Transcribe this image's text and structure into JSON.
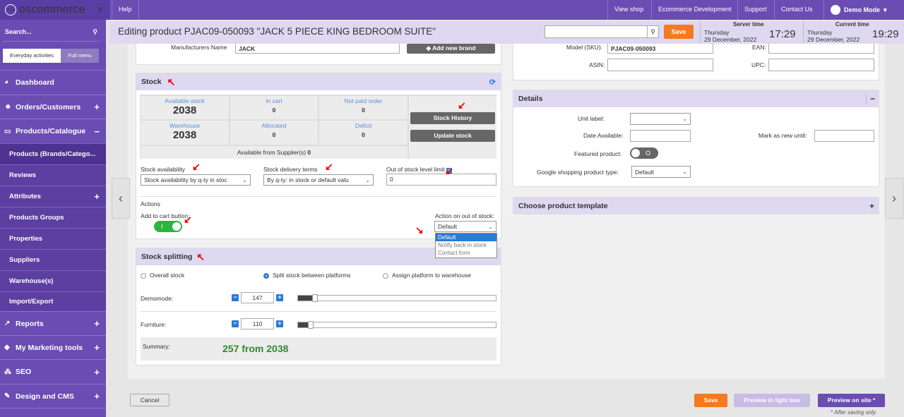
{
  "topbar": {
    "logo_text": "oscommerce",
    "help": "Help",
    "links": [
      "View shop",
      "Ecommerce Development",
      "Support",
      "Contact Us"
    ],
    "user": "Demo Mode"
  },
  "sidebar": {
    "search_label": "Search...",
    "toggle": [
      "Everyday activities",
      "Full menu"
    ],
    "items": [
      {
        "label": "Dashboard",
        "icon": "dashboard-icon",
        "plus": ""
      },
      {
        "label": "Orders/Customers",
        "icon": "users-icon",
        "plus": "+"
      },
      {
        "label": "Products/Catalogue",
        "icon": "folder-icon",
        "plus": "−"
      },
      {
        "label": "Reports",
        "icon": "chart-icon",
        "plus": "+"
      },
      {
        "label": "My Marketing tools",
        "icon": "tag-icon",
        "plus": "+"
      },
      {
        "label": "SEO",
        "icon": "sitemap-icon",
        "plus": "+"
      },
      {
        "label": "Design and CMS",
        "icon": "brush-icon",
        "plus": "+"
      }
    ],
    "subitems": [
      "Products (Brands/Catego...",
      "Reviews",
      "Attributes",
      "Products Groups",
      "Properties",
      "Suppliers",
      "Warehouse(s)",
      "Import/Export"
    ],
    "attributes_plus": "+"
  },
  "header": {
    "title": "Editing product PJAC09-050093 \"JACK 5 PIECE KING BEDROOM SUITE\"",
    "save": "Save",
    "server_label": "Server time",
    "server_day": "Thursday",
    "server_date": "29 December, 2022",
    "server_time": "17:29",
    "current_label": "Current time",
    "current_day": "Thursday",
    "current_date": "29 December, 2022",
    "current_time": "19:29"
  },
  "top_fields": {
    "manufacturers_label": "Manufacturers Name",
    "manufacturers_value": "JACK",
    "add_brand": "Add new brand",
    "model_label": "Model (SKU):",
    "model_value": "PJAC09-050093",
    "ean_label": "EAN:",
    "asin_label": "ASIN:",
    "upc_label": "UPC:"
  },
  "stock": {
    "title": "Stock",
    "cells": [
      {
        "label": "Available stock",
        "value": "2038"
      },
      {
        "label": "In cart",
        "value": "0"
      },
      {
        "label": "Not paid order",
        "value": "0"
      },
      {
        "label": "Warehouse",
        "value": "2038"
      },
      {
        "label": "Allocated",
        "value": "0"
      },
      {
        "label": "Deficit",
        "value": "0"
      }
    ],
    "history_btn": "Stock History",
    "update_btn": "Update stock",
    "supplier_label": "Available from Supplier(s)",
    "supplier_value": "0",
    "availability_label": "Stock availability",
    "availability_value": "Stock availability by q-ty in stoc",
    "delivery_label": "Stock delivery terms",
    "delivery_value": "By q-ty: in stock or default valu",
    "limit_label": "Out of stock level limit",
    "limit_value": "0",
    "actions_label": "Actions",
    "add_cart_label": "Add to cart button:",
    "toggle_text": "I",
    "oos_label": "Action on out of stock:",
    "oos_value": "Default",
    "oos_options": [
      "Default",
      "Notify back in stock",
      "Contact form"
    ]
  },
  "splitting": {
    "title": "Stock splitting",
    "options": [
      "Overall stock",
      "Split stock between platforms",
      "Assign platform to warehouse"
    ],
    "rows": [
      {
        "label": "Demomode:",
        "value": "147",
        "fraction": 0.07
      },
      {
        "label": "Furniture:",
        "value": "110",
        "fraction": 0.05
      }
    ],
    "summary_label": "Summary:",
    "summary_value": "257 from 2038"
  },
  "details": {
    "title": "Details",
    "collapse": "−",
    "unit_label": "Unit label:",
    "date_label": "Date Available:",
    "mark_new_label": "Mark as new until:",
    "featured_label": "Featured product:",
    "featured_toggle": "O",
    "google_label": "Google shopping product type:",
    "google_value": "Default"
  },
  "template": {
    "title": "Choose product template",
    "expand": "+"
  },
  "footer": {
    "cancel": "Cancel",
    "save": "Save",
    "preview_light": "Preview in light box",
    "preview_site": "Preview on site",
    "after_saving": "* After saving only"
  },
  "colors": {
    "brand_purple": "#6a4cb3",
    "accent_orange": "#f47a1f",
    "summary_green": "#2e8b2e",
    "toggle_green": "#2bb53c"
  }
}
